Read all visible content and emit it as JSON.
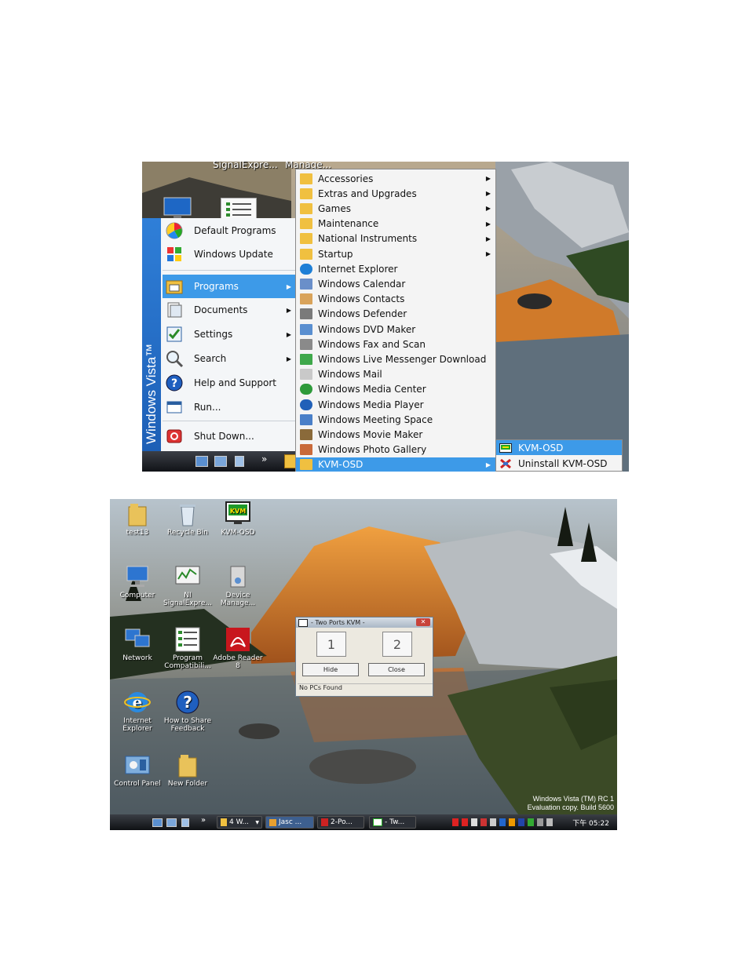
{
  "start_menu": {
    "top_labels": [
      "SignalExpre...",
      "Manage..."
    ],
    "vista_label": "Windows Vista™",
    "items": [
      {
        "label": "Default Programs",
        "icon": "default-programs-icon"
      },
      {
        "label": "Windows Update",
        "icon": "windows-update-icon"
      },
      {
        "label": "Programs",
        "icon": "programs-icon"
      },
      {
        "label": "Documents",
        "icon": "documents-icon"
      },
      {
        "label": "Settings",
        "icon": "settings-icon"
      },
      {
        "label": "Search",
        "icon": "search-icon"
      },
      {
        "label": "Help and Support",
        "icon": "help-icon"
      },
      {
        "label": "Run...",
        "icon": "run-icon"
      },
      {
        "label": "Shut Down...",
        "icon": "shutdown-icon"
      }
    ],
    "quicklaunch_more": "»"
  },
  "programs_menu": {
    "items": [
      {
        "label": "Accessories",
        "icon": "folder-icon"
      },
      {
        "label": "Extras and Upgrades",
        "icon": "folder-icon"
      },
      {
        "label": "Games",
        "icon": "folder-icon"
      },
      {
        "label": "Maintenance",
        "icon": "folder-icon"
      },
      {
        "label": "National Instruments",
        "icon": "folder-icon"
      },
      {
        "label": "Startup",
        "icon": "folder-icon"
      },
      {
        "label": "Internet Explorer",
        "icon": "ie-icon"
      },
      {
        "label": "Windows Calendar",
        "icon": "calendar-icon"
      },
      {
        "label": "Windows Contacts",
        "icon": "contacts-icon"
      },
      {
        "label": "Windows Defender",
        "icon": "defender-icon"
      },
      {
        "label": "Windows DVD Maker",
        "icon": "dvd-icon"
      },
      {
        "label": "Windows Fax and Scan",
        "icon": "fax-icon"
      },
      {
        "label": "Windows Live Messenger Download",
        "icon": "messenger-icon"
      },
      {
        "label": "Windows Mail",
        "icon": "mail-icon"
      },
      {
        "label": "Windows Media Center",
        "icon": "media-center-icon"
      },
      {
        "label": "Windows Media Player",
        "icon": "media-player-icon"
      },
      {
        "label": "Windows Meeting Space",
        "icon": "meeting-icon"
      },
      {
        "label": "Windows Movie Maker",
        "icon": "movie-icon"
      },
      {
        "label": "Windows Photo Gallery",
        "icon": "photo-icon"
      },
      {
        "label": "KVM-OSD",
        "icon": "folder-icon"
      }
    ]
  },
  "kvm_submenu": {
    "items": [
      {
        "label": "KVM-OSD",
        "icon": "kvm-icon"
      },
      {
        "label": "Uninstall KVM-OSD",
        "icon": "uninstall-icon"
      }
    ]
  },
  "desktop": {
    "icons": [
      {
        "label": "test13",
        "icon": "folder-icon"
      },
      {
        "label": "Recycle Bin",
        "icon": "recycle-bin-icon"
      },
      {
        "label": "KVM-OSD",
        "icon": "kvm-icon"
      },
      {
        "label": "Computer",
        "icon": "computer-icon"
      },
      {
        "label": "NI SignalExpre...",
        "icon": "ni-icon"
      },
      {
        "label": "Device Manage...",
        "icon": "device-manager-icon"
      },
      {
        "label": "Network",
        "icon": "network-icon"
      },
      {
        "label": "Program Compatibili...",
        "icon": "program-compat-icon"
      },
      {
        "label": "Adobe Reader 8",
        "icon": "adobe-reader-icon"
      },
      {
        "label": "Internet Explorer",
        "icon": "ie-icon"
      },
      {
        "label": "How to Share Feedback",
        "icon": "help-icon"
      },
      {
        "label": "Control Panel",
        "icon": "control-panel-icon"
      },
      {
        "label": "New Folder",
        "icon": "folder-icon"
      }
    ],
    "watermark": [
      "Windows Vista (TM) RC 1",
      "Evaluation copy. Build 5600"
    ]
  },
  "taskbar": {
    "more": "»",
    "buttons": [
      "4 W...",
      "Jasc ...",
      "2-Po...",
      "- Tw..."
    ],
    "clock": "下午 05:22"
  },
  "kvm_window": {
    "title": "- Two Ports KVM -",
    "close": "✕",
    "port1": "1",
    "port2": "2",
    "hide": "Hide",
    "close_button": "Close",
    "status": "No PCs Found"
  },
  "colors": {
    "menu_highlight": "#3d9ae8",
    "vista_strip": "#2f7fd8",
    "taskbar": "#1c1f24"
  }
}
